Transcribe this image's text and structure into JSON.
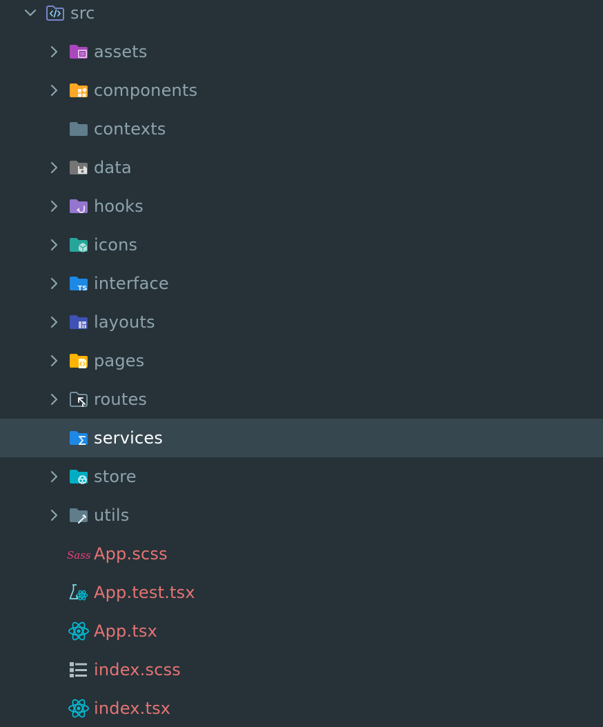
{
  "explorer": {
    "root": {
      "label": "src",
      "expanded": true,
      "icon": "folder-src-open-icon"
    },
    "items": [
      {
        "label": "assets",
        "type": "folder",
        "collapsible": true,
        "icon": "folder-assets-icon",
        "color": "#ab47bc"
      },
      {
        "label": "components",
        "type": "folder",
        "collapsible": true,
        "icon": "folder-components-icon",
        "color": "#ffa726"
      },
      {
        "label": "contexts",
        "type": "folder",
        "collapsible": false,
        "icon": "folder-icon",
        "color": "#607d8b"
      },
      {
        "label": "data",
        "type": "folder",
        "collapsible": true,
        "icon": "folder-database-icon",
        "color": "#757575"
      },
      {
        "label": "hooks",
        "type": "folder",
        "collapsible": true,
        "icon": "folder-hook-icon",
        "color": "#9575cd"
      },
      {
        "label": "icons",
        "type": "folder",
        "collapsible": true,
        "icon": "folder-icons-icon",
        "color": "#26a69a"
      },
      {
        "label": "interface",
        "type": "folder",
        "collapsible": true,
        "icon": "folder-typescript-icon",
        "color": "#1e88e5"
      },
      {
        "label": "layouts",
        "type": "folder",
        "collapsible": true,
        "icon": "folder-layout-icon",
        "color": "#3f51b5"
      },
      {
        "label": "pages",
        "type": "folder",
        "collapsible": true,
        "icon": "folder-views-icon",
        "color": "#ffb300"
      },
      {
        "label": "routes",
        "type": "folder",
        "collapsible": true,
        "icon": "folder-routes-icon",
        "color": "#607d8b"
      },
      {
        "label": "services",
        "type": "folder",
        "collapsible": false,
        "selected": true,
        "icon": "folder-services-icon",
        "color": "#1e88e5"
      },
      {
        "label": "store",
        "type": "folder",
        "collapsible": true,
        "icon": "folder-store-icon",
        "color": "#00acc1"
      },
      {
        "label": "utils",
        "type": "folder",
        "collapsible": true,
        "icon": "folder-utils-icon",
        "color": "#607d8b"
      },
      {
        "label": "App.scss",
        "type": "file",
        "modified": true,
        "icon": "sass-file-icon",
        "color": "#ec407a"
      },
      {
        "label": "App.test.tsx",
        "type": "file",
        "modified": true,
        "icon": "react-test-file-icon",
        "color": "#00bcd4"
      },
      {
        "label": "App.tsx",
        "type": "file",
        "modified": true,
        "icon": "react-file-icon",
        "color": "#00bcd4"
      },
      {
        "label": "index.scss",
        "type": "file",
        "modified": true,
        "icon": "stylesheet-file-icon",
        "color": "#b0bec5"
      },
      {
        "label": "index.tsx",
        "type": "file",
        "modified": true,
        "icon": "react-file-icon",
        "color": "#00bcd4"
      }
    ]
  },
  "colors": {
    "background": "#263238",
    "selection": "#37474f",
    "text": "#8ea3ad",
    "selected_text": "#ffffff",
    "modified_text": "#e57373"
  }
}
